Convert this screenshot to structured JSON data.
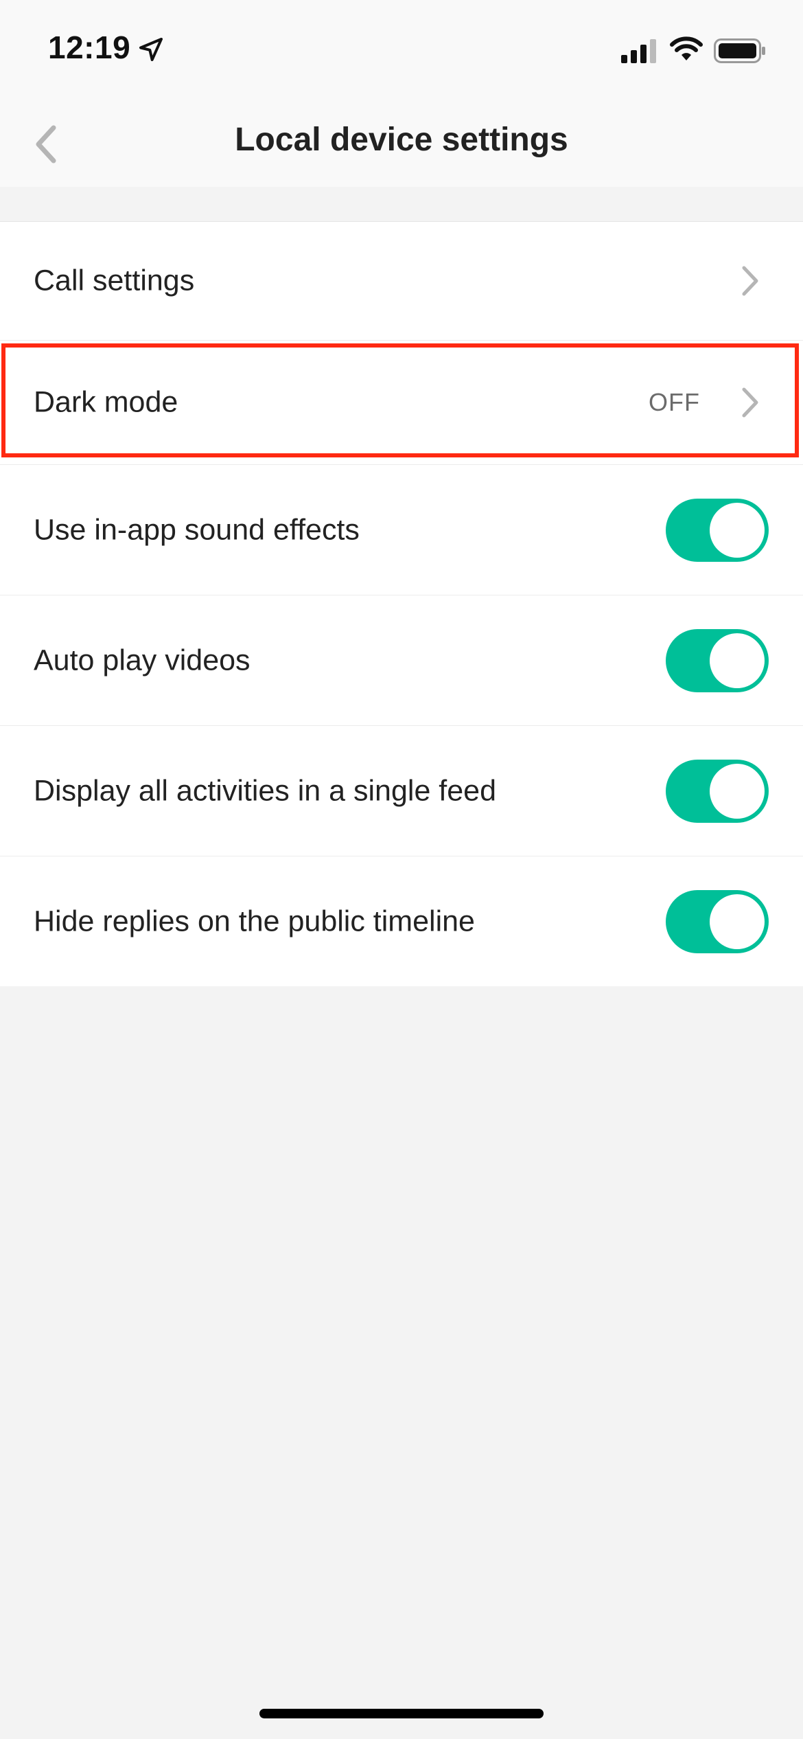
{
  "status_bar": {
    "time": "12:19",
    "icons": [
      "location-arrow-icon",
      "cellular-signal-icon",
      "wifi-icon",
      "battery-icon"
    ]
  },
  "nav": {
    "title": "Local device settings",
    "back_icon": "chevron-left-icon"
  },
  "settings": [
    {
      "label": "Call settings",
      "type": "nav"
    },
    {
      "label": "Dark mode",
      "type": "nav",
      "value": "OFF",
      "highlighted": true
    },
    {
      "label": "Use in-app sound effects",
      "type": "toggle",
      "on": true
    },
    {
      "label": "Auto play videos",
      "type": "toggle",
      "on": true
    },
    {
      "label": "Display all activities in a single feed",
      "type": "toggle",
      "on": true
    },
    {
      "label": "Hide replies on the public timeline",
      "type": "toggle",
      "on": true
    }
  ],
  "colors": {
    "toggle_on": "#00bf98",
    "highlight": "#ff2a12",
    "background": "#f3f3f3"
  }
}
